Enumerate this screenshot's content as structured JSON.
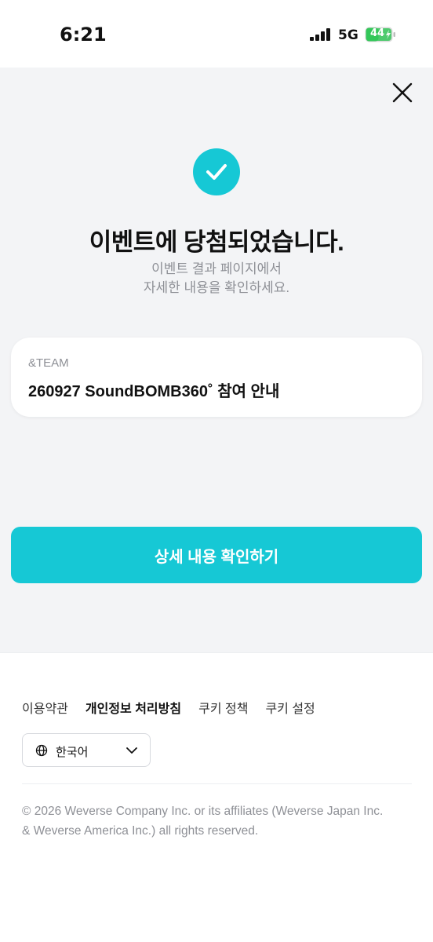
{
  "status_bar": {
    "time": "6:21",
    "network": "5G",
    "battery": "44"
  },
  "result": {
    "headline": "이벤트에 당첨되었습니다.",
    "subtext_line1": "이벤트 결과 페이지에서",
    "subtext_line2": "자세한 내용을 확인하세요."
  },
  "event_card": {
    "artist": "&TEAM",
    "title": "260927 SoundBOMB360˚ 참여 안내"
  },
  "detail_button": {
    "label": "상세 내용 확인하기"
  },
  "footer": {
    "links": [
      "이용약관",
      "개인정보 처리방침",
      "쿠키 정책",
      "쿠키 설정"
    ],
    "language": "한국어",
    "copyright_line1": "© 2026 Weverse Company Inc. or its affiliates (Weverse Japan Inc.",
    "copyright_line2": "& Weverse America Inc.) all rights reserved."
  },
  "colors": {
    "accent": "#16c8d5",
    "background": "#f3f4f6",
    "battery": "#34c759"
  },
  "icons": [
    "signal-icon",
    "battery-icon",
    "close-icon",
    "check-icon",
    "globe-icon",
    "chevron-down-icon"
  ]
}
